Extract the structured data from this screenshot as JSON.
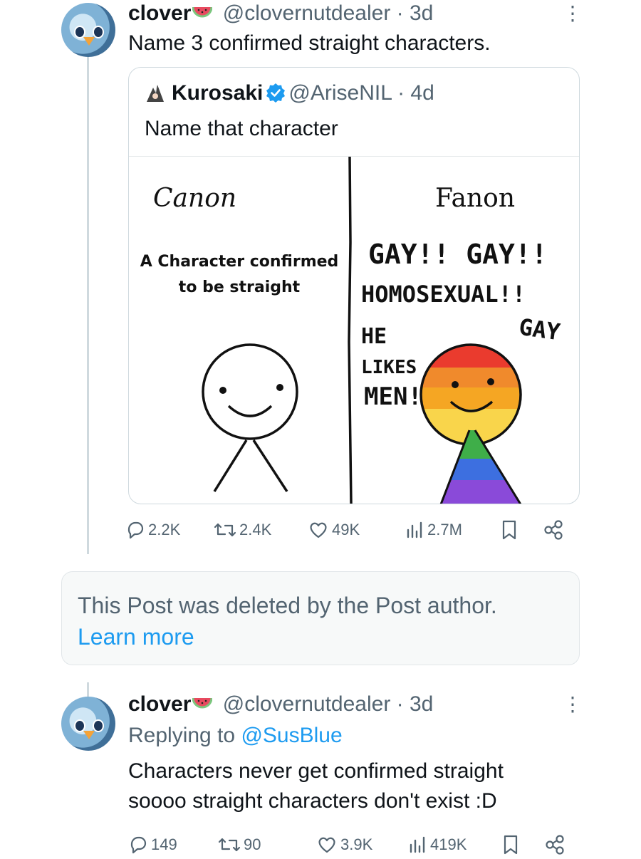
{
  "post1": {
    "name": "clover",
    "handle": "@clovernutdealer",
    "time": "· 3d",
    "text": "Name 3 confirmed straight characters.",
    "quote": {
      "name": "Kurosaki",
      "handle": "@AriseNIL",
      "time": "· 4d",
      "text": "Name that character",
      "meme": {
        "left_title": "Canon",
        "left_caption_1": "A Character confirmed",
        "left_caption_2": "to be straight",
        "right_title": "Fanon",
        "shout_1": "GAY!! GAY!!",
        "shout_2": "HOMOSEXUAL!!",
        "shout_3": "HE",
        "shout_4": "LIKES",
        "shout_5": "MEN!",
        "shout_6": "GAY"
      }
    },
    "stats": {
      "replies": "2.2K",
      "reposts": "2.4K",
      "likes": "49K",
      "views": "2.7M"
    }
  },
  "deleted": {
    "text": "This Post was deleted by the Post author.",
    "link": "Learn more"
  },
  "post2": {
    "name": "clover",
    "handle": "@clovernutdealer",
    "time": "· 3d",
    "replying_prefix": "Replying to ",
    "replying_handle": "@SusBlue",
    "line1": "Characters never get confirmed straight",
    "line2": "soooo straight characters don't exist :D",
    "stats": {
      "replies": "149",
      "reposts": "90",
      "likes": "3.9K",
      "views": "419K"
    }
  },
  "colors": {
    "accent": "#1d9bf0",
    "secondary_text": "#536471",
    "border": "#cfd9de"
  },
  "icons": [
    "watermelon-icon",
    "verified-badge-icon",
    "reply-icon",
    "repost-icon",
    "like-icon",
    "views-icon",
    "bookmark-icon",
    "share-icon",
    "more-icon"
  ]
}
